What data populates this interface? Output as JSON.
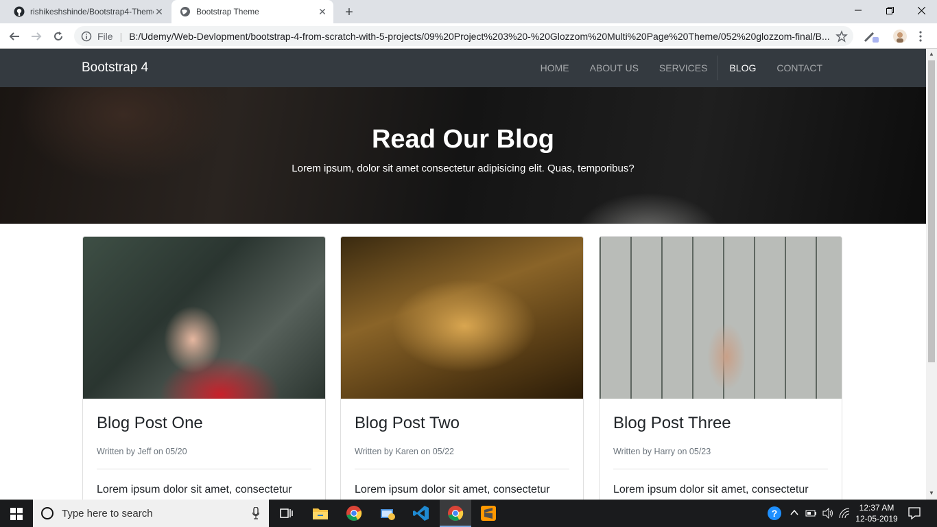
{
  "browser": {
    "tabs": [
      {
        "title": "rishikeshshinde/Bootstrap4-Theme",
        "active": false
      },
      {
        "title": "Bootstrap Theme",
        "active": true
      }
    ],
    "address": {
      "scheme_label": "File",
      "url": "B:/Udemy/Web-Devlopment/bootstrap-4-from-scratch-with-5-projects/09%20Project%203%20-%20Glozzom%20Multi%20Page%20Theme/052%20glozzom-final/B..."
    }
  },
  "page": {
    "navbar": {
      "brand": "Bootstrap 4",
      "links": [
        {
          "label": "HOME",
          "active": false
        },
        {
          "label": "ABOUT US",
          "active": false
        },
        {
          "label": "SERVICES",
          "active": false
        },
        {
          "label": "BLOG",
          "active": true
        },
        {
          "label": "CONTACT",
          "active": false
        }
      ]
    },
    "hero": {
      "title": "Read Our Blog",
      "subtitle": "Lorem ipsum, dolor sit amet consectetur adipisicing elit. Quas, temporibus?"
    },
    "posts": [
      {
        "title": "Blog Post One",
        "meta": "Written by Jeff on 05/20",
        "excerpt": "Lorem ipsum dolor sit amet, consectetur"
      },
      {
        "title": "Blog Post Two",
        "meta": "Written by Karen on 05/22",
        "excerpt": "Lorem ipsum dolor sit amet, consectetur"
      },
      {
        "title": "Blog Post Three",
        "meta": "Written by Harry on 05/23",
        "excerpt": "Lorem ipsum dolor sit amet, consectetur"
      }
    ]
  },
  "taskbar": {
    "search_placeholder": "Type here to search",
    "time": "12:37 AM",
    "date": "12-05-2019"
  }
}
